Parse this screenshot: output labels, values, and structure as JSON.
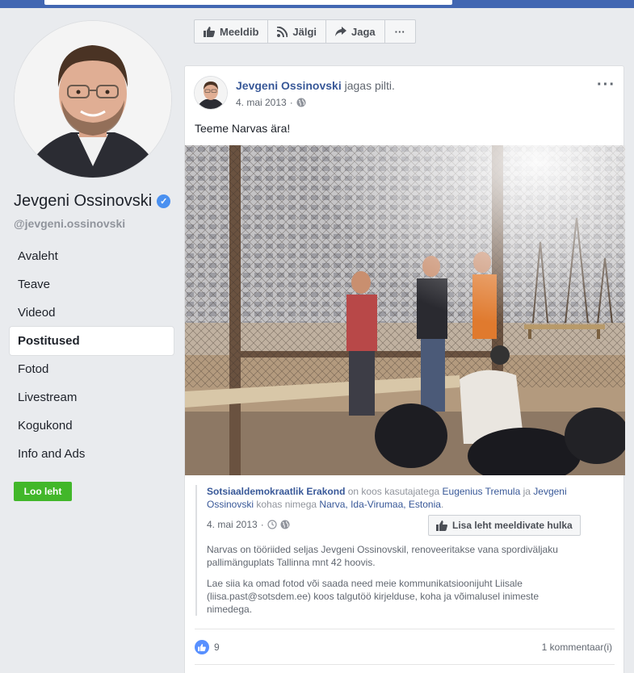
{
  "page": {
    "name": "Jevgeni Ossinovski",
    "handle": "@jevgeni.ossinovski",
    "verified_icon": "verified-check-icon"
  },
  "nav": [
    {
      "label": "Avaleht",
      "active": false
    },
    {
      "label": "Teave",
      "active": false
    },
    {
      "label": "Videod",
      "active": false
    },
    {
      "label": "Postitused",
      "active": true
    },
    {
      "label": "Fotod",
      "active": false
    },
    {
      "label": "Livestream",
      "active": false
    },
    {
      "label": "Kogukond",
      "active": false
    },
    {
      "label": "Info and Ads",
      "active": false
    }
  ],
  "create_page_label": "Loo leht",
  "actions": {
    "like": "Meeldib",
    "follow": "Jälgi",
    "share": "Jaga",
    "more": "···"
  },
  "post": {
    "author": "Jevgeni Ossinovski",
    "action_text": "jagas pilti.",
    "date": "4. mai 2013",
    "dot": "·",
    "text": "Teeme Narvas ära!",
    "more": "···"
  },
  "shared": {
    "org": "Sotsiaaldemokraatlik Erakond",
    "with_text": "on koos kasutajatega",
    "person1": "Eugenius Tremula",
    "and": "ja",
    "person2": "Jevgeni Ossinovski",
    "at_text": "kohas nimega",
    "place": "Narva, Ida-Virumaa, Estonia",
    "period": ".",
    "date": "4. mai 2013",
    "dot": "·",
    "like_page_button": "Lisa leht meeldivate hulka",
    "body1": "Narvas on tööriided seljas Jevgeni Ossinovskil, renoveeritakse vana spordiväljaku pallimänguplats Tallinna mnt 42 hoovis.",
    "body2": "Lae siia ka omad fotod või saada need meie kommunikatsioonijuht Liisale (liisa.past@sotsdem.ee) koos talgutöö kirjelduse, koha ja võimalusel inimeste nimedega."
  },
  "footer": {
    "like_count": "9",
    "comments": "1 kommentaar(i)"
  },
  "colors": {
    "brand": "#4267b2",
    "link": "#385898",
    "create_button": "#42b72a",
    "like": "#5890ff"
  }
}
